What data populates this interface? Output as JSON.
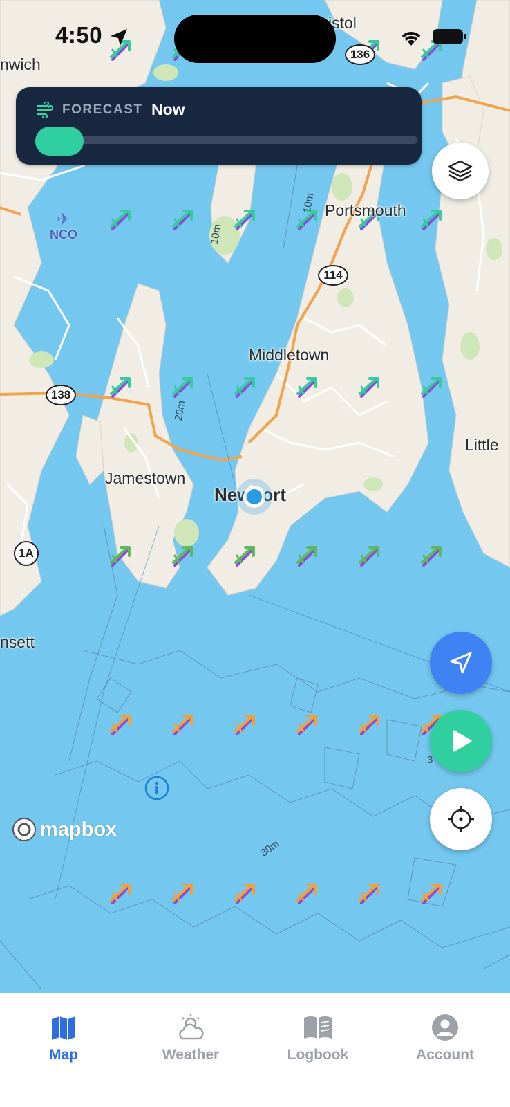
{
  "status_bar": {
    "time": "4:50"
  },
  "forecast": {
    "kicker": "FORECAST",
    "value": "Now",
    "timeline_position": 0,
    "accent_color": "#2fcf9f"
  },
  "map": {
    "labels": {
      "bristol": "Bristol",
      "warwick": "nwich",
      "portsmouth": "Portsmouth",
      "middletown": "Middletown",
      "jamestown": "Jamestown",
      "newport": "Newport",
      "little_compton": "Little",
      "narragansett": "nsett",
      "nco": "NCO"
    },
    "routes": [
      "136",
      "114",
      "138",
      "1A"
    ],
    "depths": [
      "10m",
      "10m",
      "20m",
      "30m",
      "3"
    ],
    "attribution": "mapbox",
    "info_icon": "info-icon"
  },
  "buttons": {
    "layers": "layers-icon",
    "navigate": "navigation-arrow-icon",
    "play": "play-icon",
    "locate": "crosshair-icon"
  },
  "colors": {
    "water": "#74c8ef",
    "land": "#f1ede4",
    "panel": "#182841",
    "nav_blue": "#3f82f4",
    "play_green": "#2fcf9f",
    "active_tab": "#2d6fe0",
    "inactive_tab": "#9da1a8"
  },
  "tabs": [
    {
      "label": "Map",
      "icon": "map-icon",
      "active": true
    },
    {
      "label": "Weather",
      "icon": "weather-icon",
      "active": false
    },
    {
      "label": "Logbook",
      "icon": "logbook-icon",
      "active": false
    },
    {
      "label": "Account",
      "icon": "account-icon",
      "active": false
    }
  ]
}
